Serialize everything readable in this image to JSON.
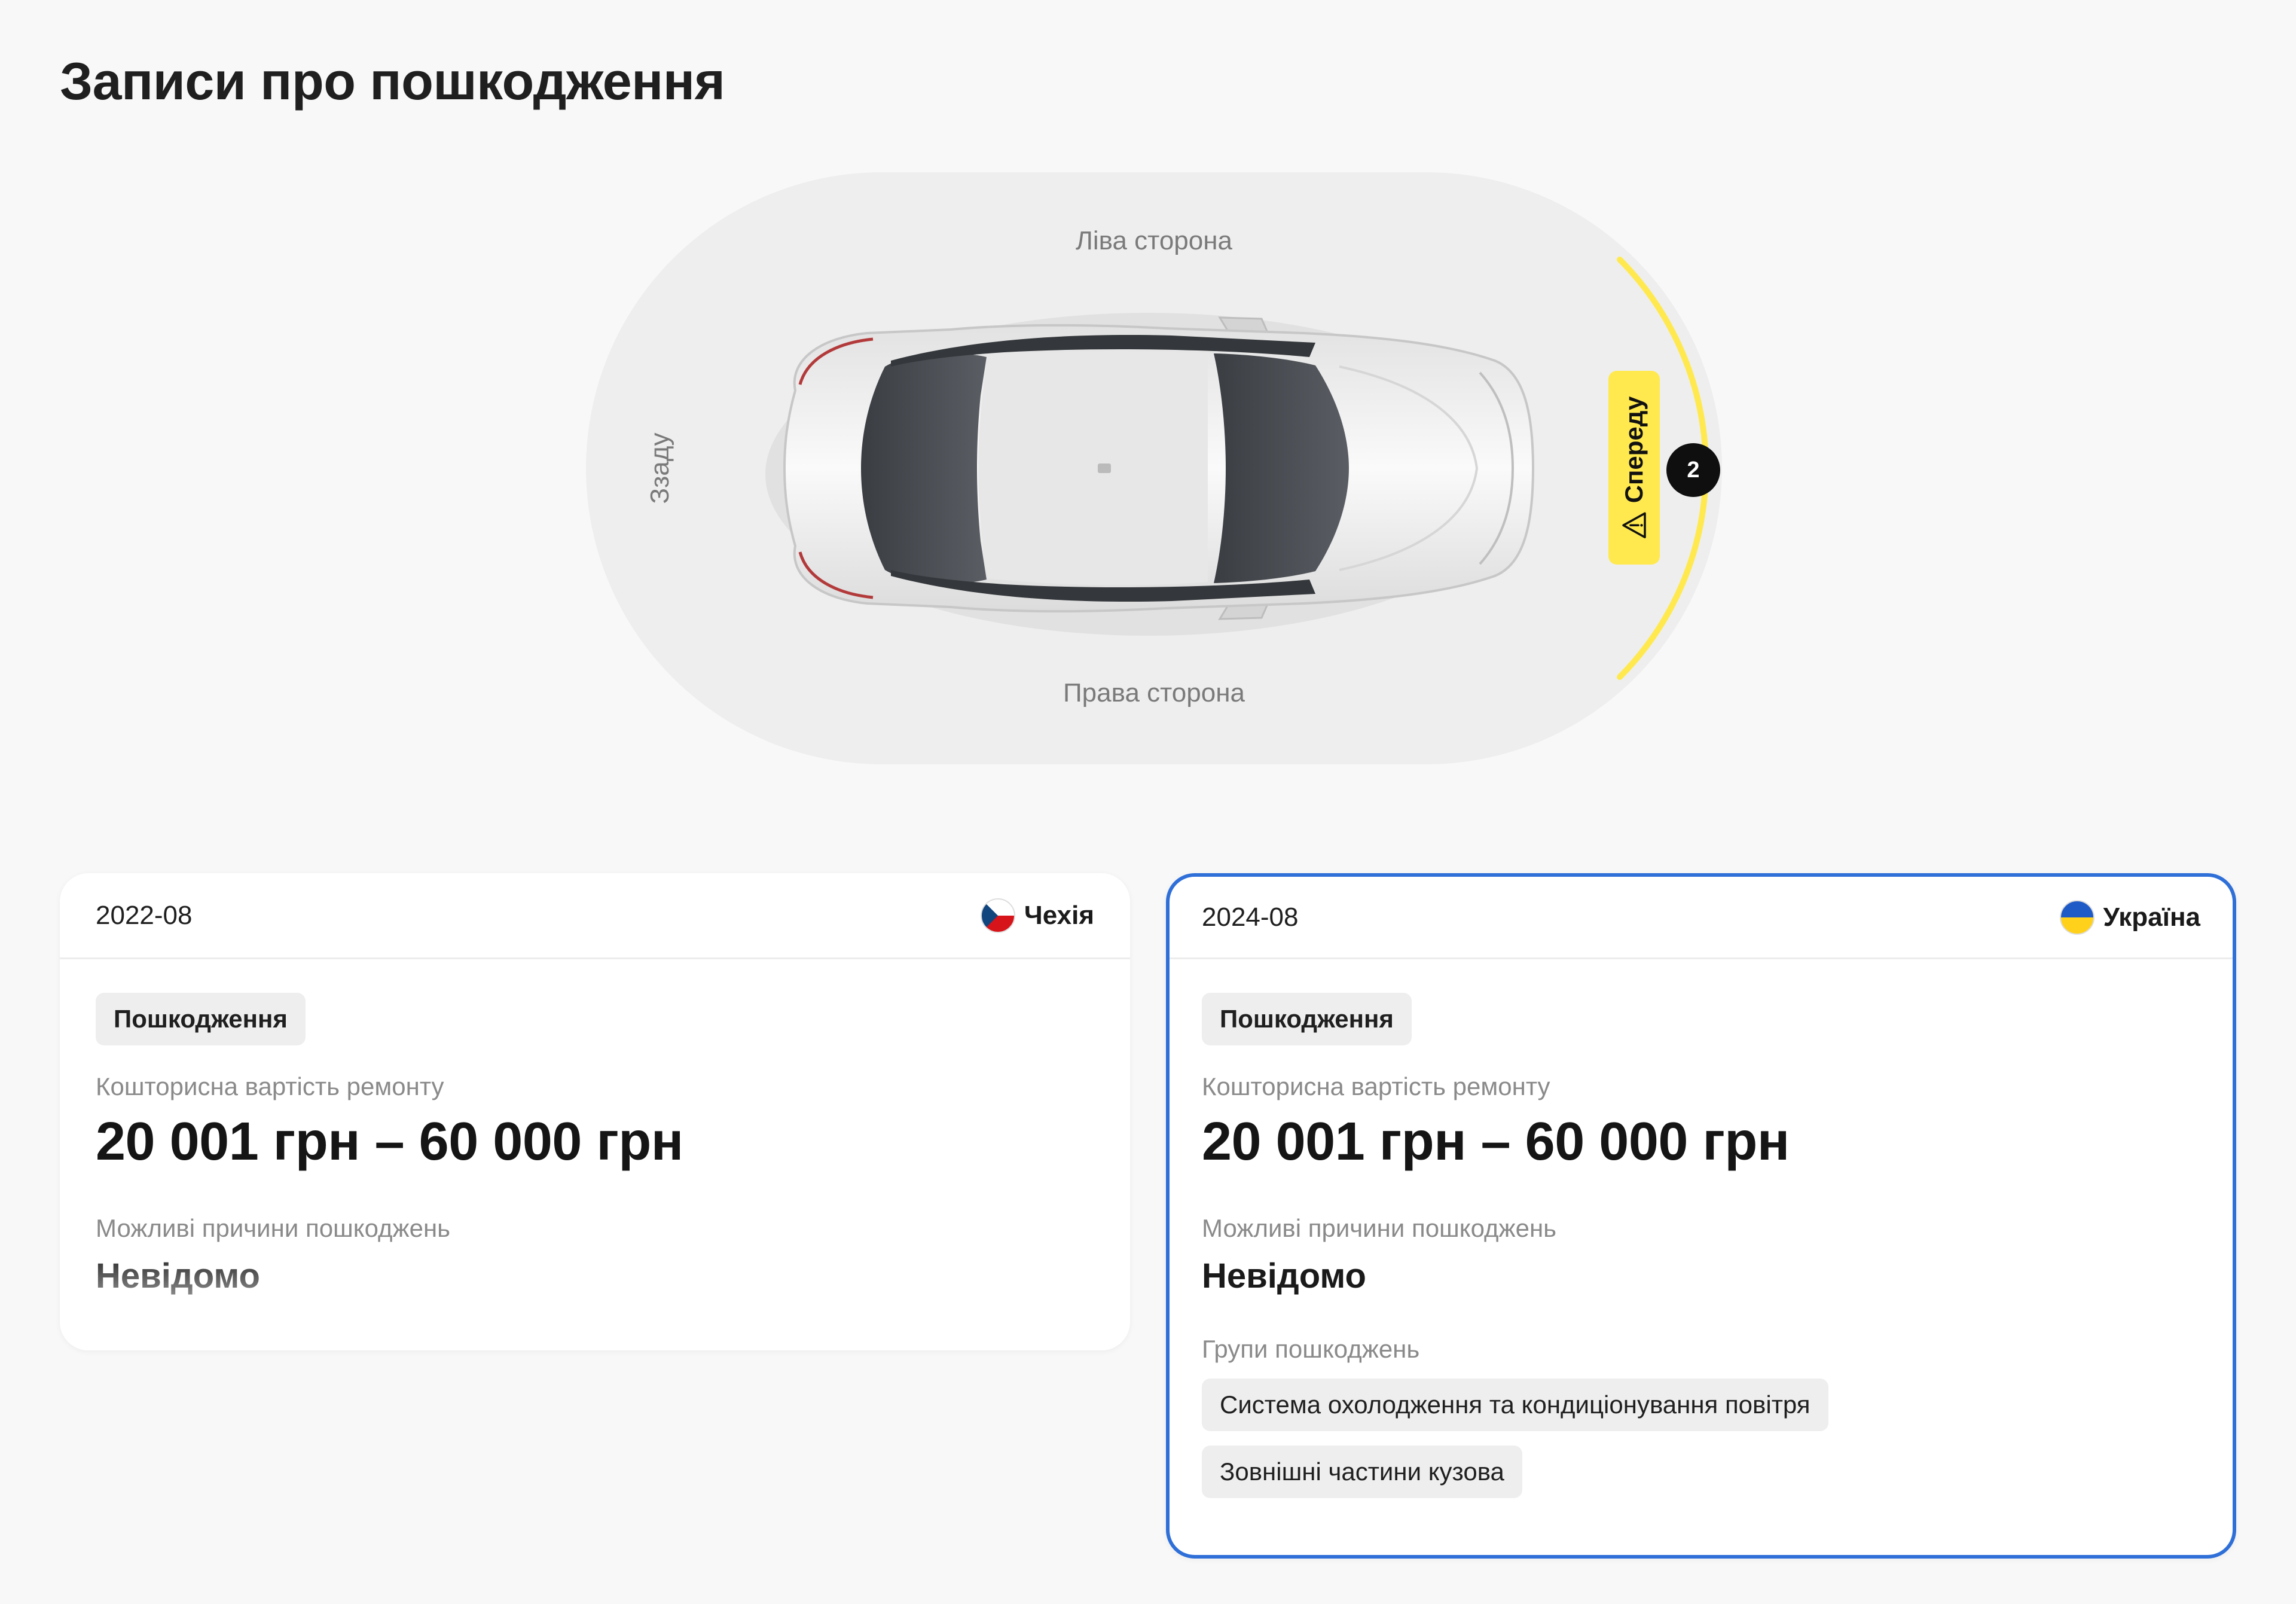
{
  "page": {
    "title": "Записи про пошкодження"
  },
  "diagram": {
    "left_side_label": "Ліва сторона",
    "right_side_label": "Права сторона",
    "rear_label": "Ззаду",
    "front_label": "Спереду",
    "front_damage_count": "2",
    "highlight_color": "#ffe94f",
    "highlighted_zone": "front",
    "warning_icon": "warning-triangle-icon"
  },
  "records": [
    {
      "date": "2022-08",
      "country": "Чехія",
      "flag_icon": "czech-flag-icon",
      "type": "Пошкодження",
      "cost_label": "Кошторисна вартість ремонту",
      "cost": "20 001 грн – 60 000 грн",
      "causes_label": "Можливі причини пошкоджень",
      "causes": "Невідомо"
    },
    {
      "date": "2024-08",
      "country": "Україна",
      "flag_icon": "ukraine-flag-icon",
      "type": "Пошкодження",
      "cost_label": "Кошторисна вартість ремонту",
      "cost": "20 001 грн – 60 000 грн",
      "causes_label": "Можливі причини пошкоджень",
      "causes": "Невідомо",
      "groups_label": "Групи пошкоджень",
      "groups": [
        "Система охолодження та кондиціонування повітря",
        "Зовнішні частини кузова"
      ],
      "selected": true,
      "selected_border_color": "#2f6fd8"
    }
  ]
}
